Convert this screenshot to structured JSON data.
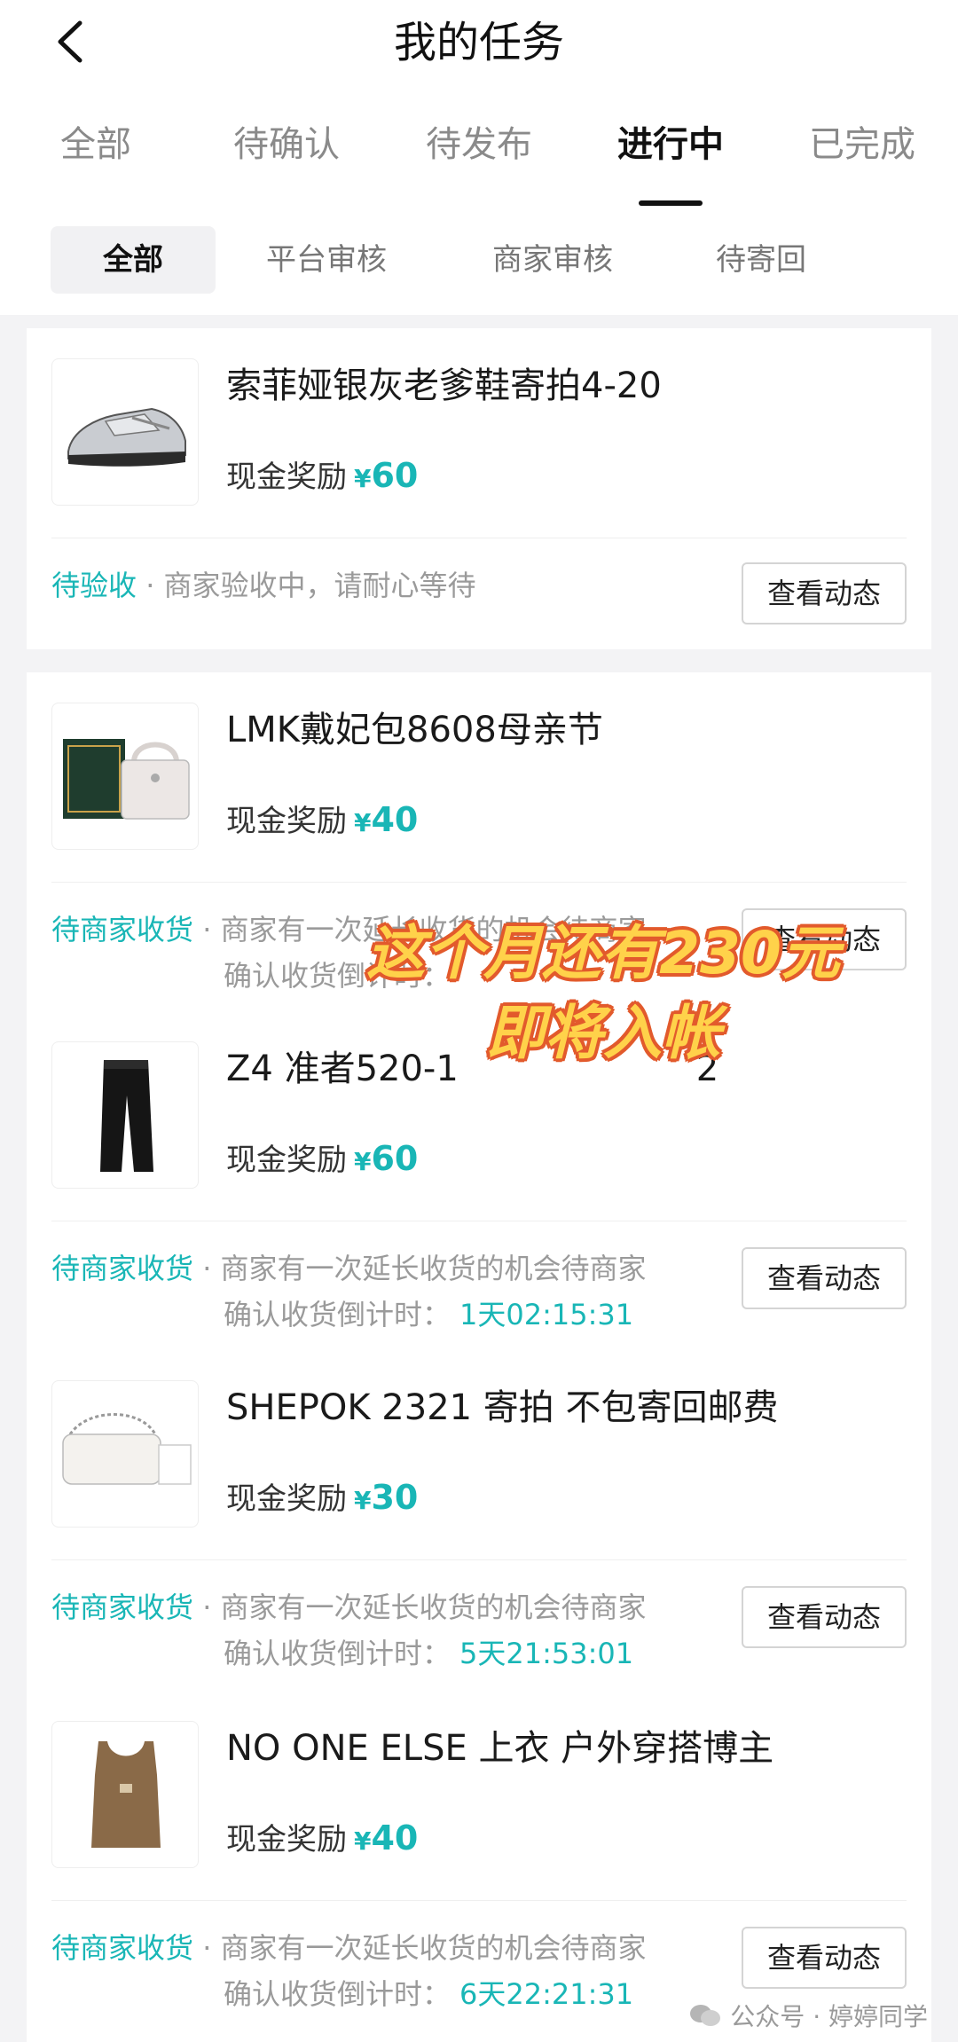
{
  "header": {
    "title": "我的任务"
  },
  "tabs": [
    {
      "label": "全部"
    },
    {
      "label": "待确认"
    },
    {
      "label": "待发布"
    },
    {
      "label": "进行中",
      "active": true
    },
    {
      "label": "已完成"
    }
  ],
  "subtabs": [
    {
      "label": "全部",
      "active": true
    },
    {
      "label": "平台审核"
    },
    {
      "label": "商家审核"
    },
    {
      "label": "待寄回"
    }
  ],
  "tasks": [
    {
      "title": "索菲娅银灰老爹鞋寄拍4-20",
      "reward_label": "现金奖励",
      "reward_currency": "¥",
      "reward_amount": "60",
      "status_tag": "待验收",
      "status_desc": " · 商家验收中，请耐心等待",
      "button": "查看动态",
      "image": "silver-sneaker"
    },
    {
      "title": "LMK戴妃包8608母亲节",
      "reward_label": "现金奖励",
      "reward_currency": "¥",
      "reward_amount": "40",
      "status_tag": "待商家收货",
      "status_desc": " · 商家有一次延长收货的机会待商家",
      "status_line2": "确认收货倒计时：",
      "button": "查看动态",
      "image": "handbag-with-box"
    },
    {
      "title": "Z4 准者520-1",
      "title_tail": "2",
      "reward_label": "现金奖励",
      "reward_currency": "¥",
      "reward_amount": "60",
      "status_tag": "待商家收货",
      "status_desc": " · 商家有一次延长收货的机会待商家",
      "status_line2": "确认收货倒计时：",
      "countdown": "1天02:15:31",
      "button": "查看动态",
      "image": "black-pants"
    },
    {
      "title": "SHEPOK 2321 寄拍 不包寄回邮费",
      "reward_label": "现金奖励",
      "reward_currency": "¥",
      "reward_amount": "30",
      "status_tag": "待商家收货",
      "status_desc": " · 商家有一次延长收货的机会待商家",
      "status_line2": "确认收货倒计时：",
      "countdown": "5天21:53:01",
      "button": "查看动态",
      "image": "white-chain-bag"
    },
    {
      "title": "NO ONE ELSE 上衣 户外穿搭博主",
      "reward_label": "现金奖励",
      "reward_currency": "¥",
      "reward_amount": "40",
      "status_tag": "待商家收货",
      "status_desc": " · 商家有一次延长收货的机会待商家",
      "status_line2": "确认收货倒计时：",
      "countdown": "6天22:21:31",
      "button": "查看动态",
      "image": "brown-tank-top"
    }
  ],
  "overlay": {
    "line1": "这个月还有230元",
    "line2": "即将入帐"
  },
  "watermark": {
    "text": "公众号 · 婷婷同学",
    "icon": "wechat-icon"
  },
  "colors": {
    "accent": "#19b6b6",
    "overlay_fill": "#ffd24a",
    "overlay_stroke": "#e25a2c"
  }
}
